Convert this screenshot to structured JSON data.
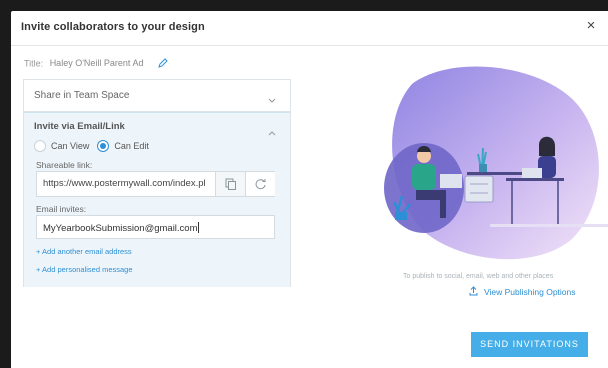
{
  "header": {
    "title": "Invite collaborators to your design",
    "close_label": "×"
  },
  "title_field": {
    "label": "Title:",
    "value": "Haley O'Neill Parent Ad"
  },
  "team_space": {
    "label": "Share in Team Space"
  },
  "email_section": {
    "title": "Invite via Email/Link",
    "options": [
      {
        "label": "Can View",
        "selected": false
      },
      {
        "label": "Can Edit",
        "selected": true
      }
    ],
    "shareable_label": "Shareable link:",
    "shareable_value": "https://www.postermywall.com/index.pl",
    "email_label": "Email invites:",
    "email_value": "MyYearbookSubmission@gmail.com",
    "add_email": "+ Add another email address",
    "add_message": "+ Add personalised message"
  },
  "publish": {
    "text": "To publish to social, email, web and other places",
    "link": "View Publishing Options"
  },
  "send_button": "SEND INVITATIONS",
  "colors": {
    "accent": "#2d8fd5",
    "button": "#45aee8",
    "panel_bg": "#eef5fa",
    "illustration": "#a99be8"
  },
  "icons": [
    "close-icon",
    "pencil-icon",
    "chevron-down-icon",
    "chevron-up-icon",
    "copy-icon",
    "refresh-icon",
    "upload-icon"
  ]
}
